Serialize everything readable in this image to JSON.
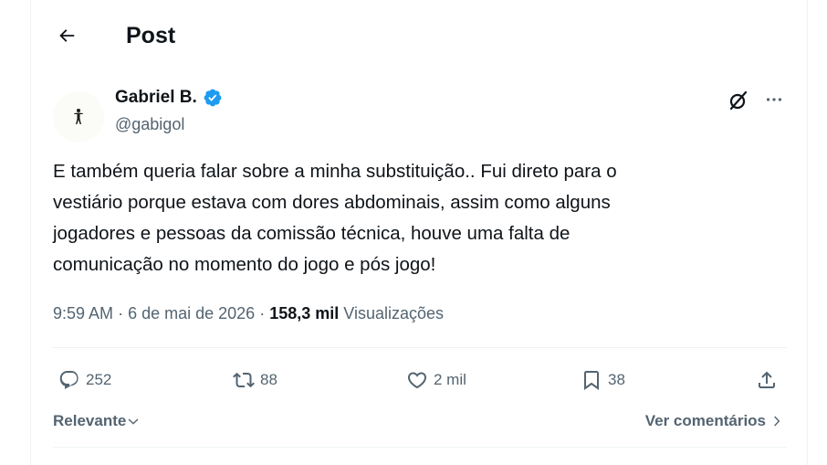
{
  "header": {
    "title": "Post",
    "back_icon": "arrow-left-icon"
  },
  "author": {
    "name": "Gabriel B.",
    "handle": "@gabigol",
    "verified": true,
    "verified_color": "#1d9bf0",
    "avatar_icon": "person-silhouette-icon"
  },
  "post": {
    "text": "E também queria falar sobre a minha substituição.. Fui direto para o\nvestiário porque estava com dores abdominais, assim como alguns\njogadores e pessoas da comissão técnica, houve uma falta de\ncomunicação no momento do jogo e pós jogo!",
    "time": "9:59 AM",
    "separator": "·",
    "date": "6 de mai de 2026",
    "views_count": "158,3 mil",
    "views_label": "Visualizações"
  },
  "actions": {
    "replies": "252",
    "reposts": "88",
    "likes": "2 mil",
    "bookmarks": "38"
  },
  "footer": {
    "sort_label": "Relevante",
    "comments_link": "Ver comentários"
  },
  "colors": {
    "text": "#0f1419",
    "secondary": "#536471",
    "divider": "#eff3f4"
  }
}
